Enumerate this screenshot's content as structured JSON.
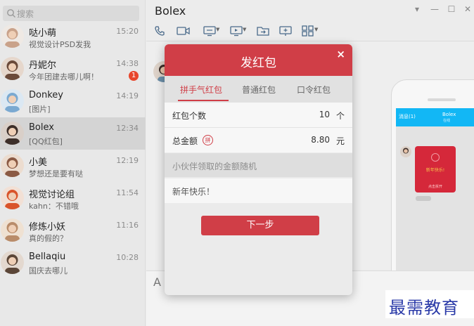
{
  "search": {
    "placeholder": "搜索",
    "icon": "search-icon"
  },
  "conversations": [
    {
      "name": "哒小萌",
      "preview": "视觉设计PSD发我",
      "time": "15:20",
      "badge": "",
      "avatar_color": "#c9a28a",
      "avatar_bg": "#efe9e4"
    },
    {
      "name": "丹妮尔",
      "preview": "今年团建去哪儿啊！",
      "time": "14:38",
      "badge": "1",
      "avatar_color": "#6b4a3a",
      "avatar_bg": "#e6d7cc"
    },
    {
      "name": "Donkey",
      "preview": "[图片]",
      "time": "14:19",
      "badge": "",
      "avatar_color": "#7aa9d1",
      "avatar_bg": "#dbe8f3"
    },
    {
      "name": "Bolex",
      "preview": "[QQ红包]",
      "time": "12:34",
      "badge": "",
      "avatar_color": "#3d2f2a",
      "avatar_bg": "#d9cfc8"
    },
    {
      "name": "小美",
      "preview": "梦想还是要有哒",
      "time": "12:19",
      "badge": "",
      "avatar_color": "#8b5a44",
      "avatar_bg": "#ecdccf"
    },
    {
      "name": "视觉讨论组",
      "preview": "kahn：不错哦",
      "time": "11:54",
      "badge": "",
      "avatar_color": "#d9542b",
      "avatar_bg": "#f2e0d5"
    },
    {
      "name": "修炼小妖",
      "preview": "真的假的？",
      "time": "11:16",
      "badge": "",
      "avatar_color": "#b98c6a",
      "avatar_bg": "#efe1d2"
    },
    {
      "name": "Bellaqiu",
      "preview": "国庆去哪儿",
      "time": "10:28",
      "badge": "",
      "avatar_color": "#5b4638",
      "avatar_bg": "#e3d8cf"
    }
  ],
  "chat": {
    "title": "Bolex",
    "window_controls": [
      "▾",
      "—",
      "☐",
      "✕"
    ],
    "toolbar_icons": [
      "phone-icon",
      "video-icon",
      "screen-share-icon",
      "remote-desktop-icon",
      "file-transfer-icon",
      "whiteboard-icon",
      "apps-icon"
    ],
    "font_icon": "A"
  },
  "dialog": {
    "title": "发红包",
    "close": "×",
    "tabs": [
      "拼手气红包",
      "普通红包",
      "口令红包"
    ],
    "active_tab": 0,
    "count_label": "红包个数",
    "count_value": "10",
    "count_unit": "个",
    "amount_label": "总金额",
    "amount_badge": "拼",
    "amount_value": "8.80",
    "amount_unit": "元",
    "note": "小伙伴领取的金额随机",
    "greeting": "新年快乐！",
    "next_button": "下一步"
  },
  "phone_preview": {
    "back": "消息(1)",
    "title": "Bolex",
    "subtitle": "在线",
    "packet_text": "新年快乐!",
    "packet_open": "点击拆开",
    "header_color": "#12b7f5",
    "packet_color": "#d5283a"
  },
  "watermark": "最需教育",
  "colors": {
    "accent": "#d03e47",
    "badge": "#e8462c"
  }
}
